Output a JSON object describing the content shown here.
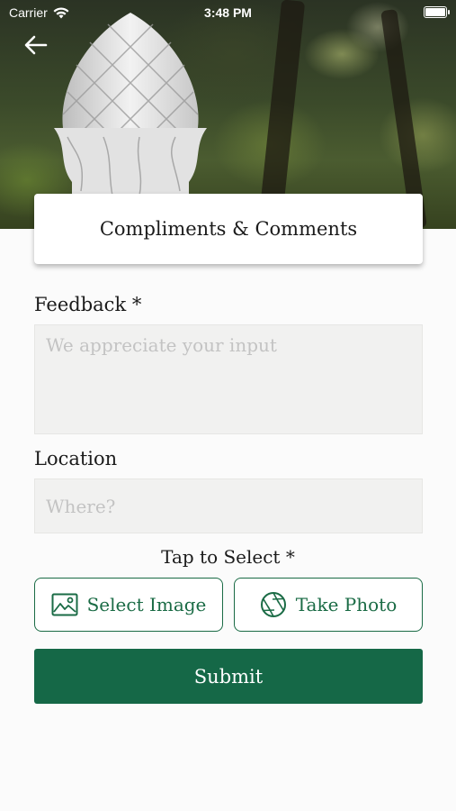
{
  "status_bar": {
    "carrier": "Carrier",
    "time": "3:48 PM"
  },
  "header": {
    "back_icon": "arrow-left-icon",
    "title": "Compliments & Comments"
  },
  "form": {
    "feedback_label": "Feedback *",
    "feedback_placeholder": "We appreciate your input",
    "feedback_value": "",
    "location_label": "Location",
    "location_placeholder": "Where?",
    "location_value": "",
    "tap_label": "Tap to Select *",
    "select_image_label": "Select Image",
    "select_image_icon": "image-icon",
    "take_photo_label": "Take Photo",
    "take_photo_icon": "camera-aperture-icon",
    "submit_label": "Submit"
  },
  "colors": {
    "accent": "#1a6b45",
    "submit_bg": "#156847",
    "field_bg": "#f1f1f0"
  }
}
